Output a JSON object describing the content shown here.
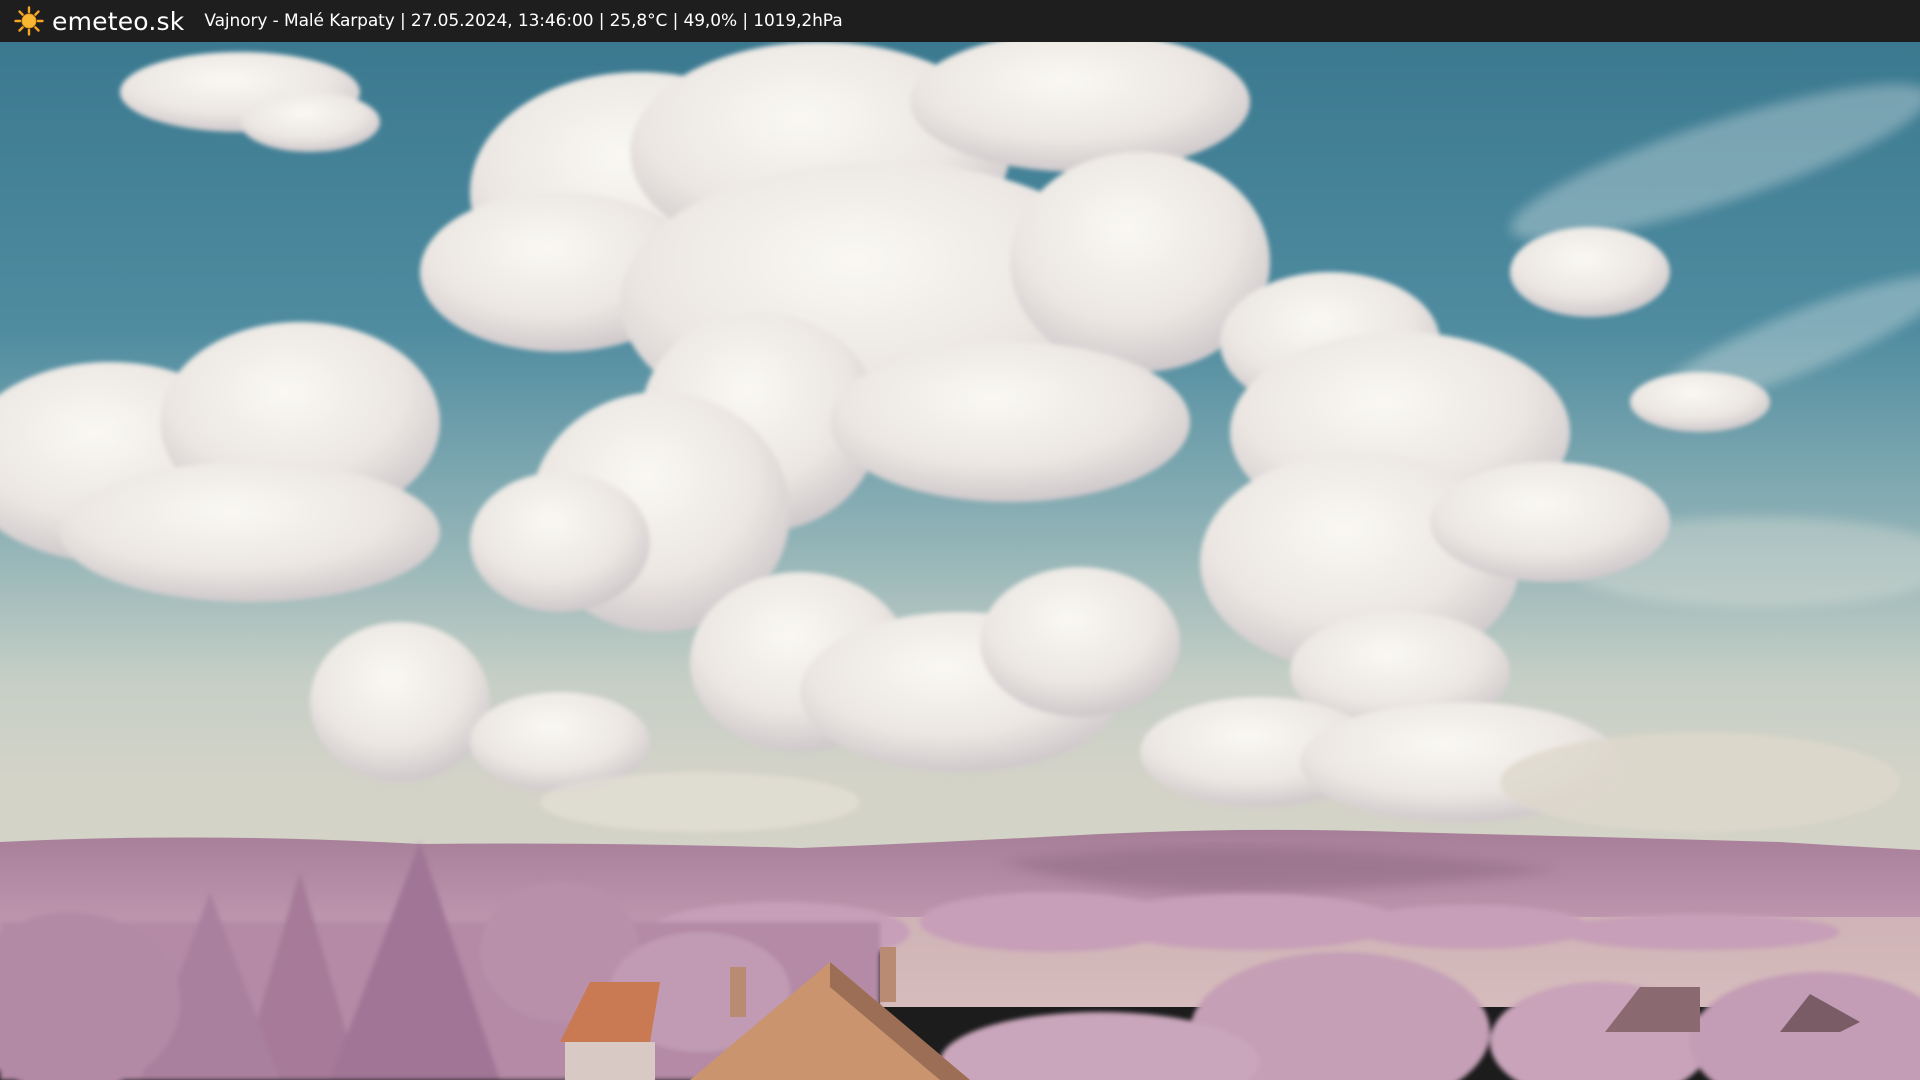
{
  "header": {
    "brand": "emeteo.sk",
    "caption": "Vajnory - Malé Karpaty | 27.05.2024, 13:46:00 | 25,8°C | 49,0% | 1019,2hPa",
    "logo_icon": "sun-icon"
  },
  "colors": {
    "bar_background": "#1e1e1e",
    "sun": "#f5a623",
    "sky_top": "#3d7d93",
    "sky_horizon": "#cfd0c4",
    "foliage": "#b98aa8",
    "roof": "#c97a52"
  }
}
